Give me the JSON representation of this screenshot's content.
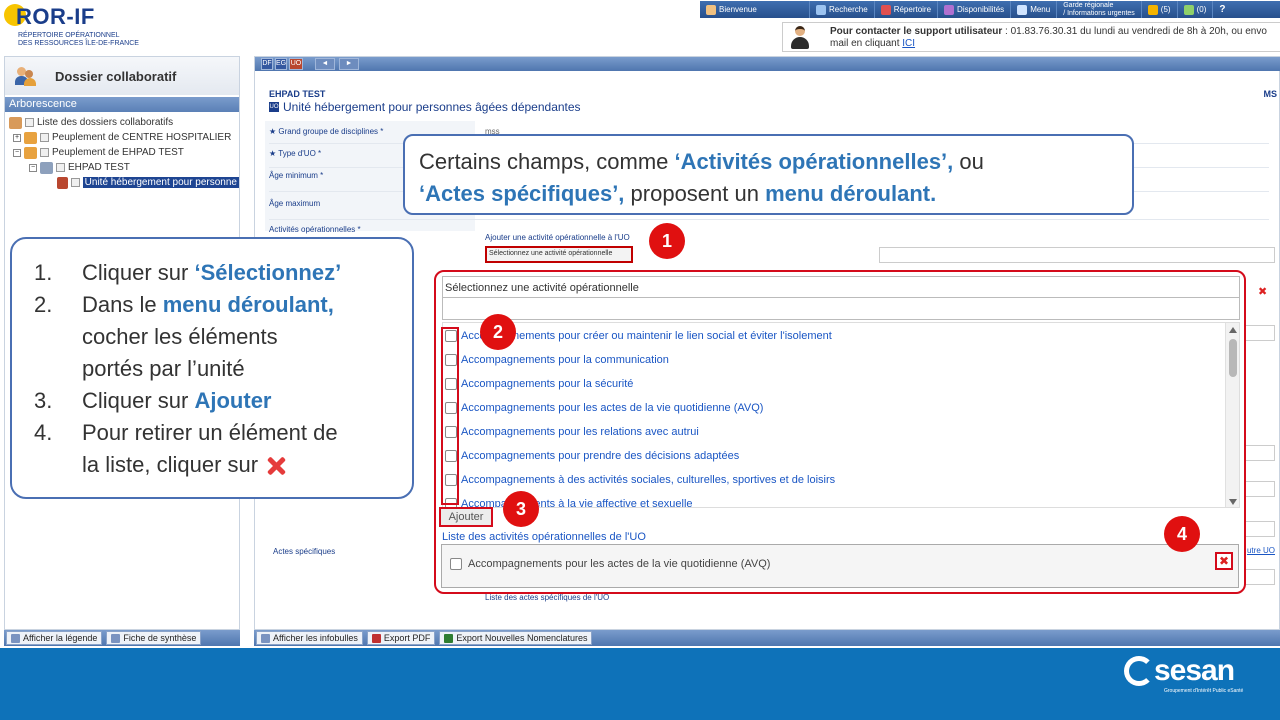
{
  "header": {
    "logo_title": "ROR-IF",
    "logo_sub_1": "RÉPERTOIRE OPÉRATIONNEL",
    "logo_sub_2": "DES RESSOURCES ÎLE-DE-FRANCE",
    "nav": {
      "bienvenue": "Bienvenue",
      "recherche": "Recherche",
      "repertoire": "Répertoire",
      "disponibilites": "Disponibilités",
      "menu": "Menu",
      "garde_1": "Garde régionale",
      "garde_2": "/ Informations urgentes",
      "alerts_count": "(5)",
      "notif_count": "(0)",
      "help": "?"
    },
    "support": {
      "bold": "Pour contacter le support utilisateur",
      "line1_rest": " : 01.83.76.30.31 du lundi au vendredi de 8h à 20h, ou envo",
      "line2": "mail en cliquant ",
      "link": "ICI"
    }
  },
  "left_panel": {
    "title": "Dossier collaboratif",
    "arbo": "Arborescence",
    "tree": {
      "root": "Liste des dossiers collaboratifs",
      "item1": "Peuplement de CENTRE HOSPITALIER",
      "item2": "Peuplement de EHPAD TEST",
      "item3": "EHPAD TEST",
      "item4": "Unité hébergement pour personne"
    },
    "bottom": {
      "legende": "Afficher la légende",
      "synthese": "Fiche de synthèse"
    }
  },
  "main": {
    "toolbar": {
      "df": "DF",
      "eg": "EG",
      "uo": "UO"
    },
    "ehpad": "EHPAD TEST",
    "uo_badge": "UO",
    "uo_title": "Unité hébergement pour personnes âgées dépendantes",
    "ms": "MS",
    "fields": {
      "grand_groupe": "Grand groupe de disciplines *",
      "grand_groupe_value": "mss",
      "type_uo": "Type d'UO *",
      "age_min": "Âge minimum *",
      "age_max": "Âge maximum",
      "activites": "Activités opérationnelles *",
      "actes": "Actes spécifiques"
    },
    "ajouter_activite_label": "Ajouter une activité opérationnelle à l'UO",
    "select_placeholder": "Sélectionnez une activité opérationnelle",
    "actes_bottom": "Liste des actes spécifiques de l'UO",
    "autre_uo": "utre UO",
    "bottom": {
      "infobulles": "Afficher les infobulles",
      "pdf": "Export PDF",
      "nomenclatures": "Export Nouvelles Nomenclatures"
    }
  },
  "dropdown": {
    "header": "Sélectionnez une activité opérationnelle",
    "items": [
      "Accompagnements pour créer ou maintenir le lien social et éviter l'isolement",
      "Accompagnements pour la communication",
      "Accompagnements pour la sécurité",
      "Accompagnements pour les actes de la vie quotidienne (AVQ)",
      "Accompagnements pour les relations avec autrui",
      "Accompagnements pour prendre des décisions adaptées",
      "Accompagnements à des activités sociales, culturelles, sportives et de loisirs",
      "Accompagnements à la vie affective et sexuelle"
    ],
    "ajouter": "Ajouter",
    "liste_label": "Liste des activités opérationnelles de l'UO",
    "liste_item": "Accompagnements pour les actes de la vie quotidienne (AVQ)",
    "remove": "✖"
  },
  "steps": {
    "s1": "1",
    "s2": "2",
    "s3": "3",
    "s4": "4"
  },
  "callout_top": {
    "t1": "Certains champs, comme ",
    "h1": "‘Activités opérationnelles’,",
    "t2": " ou",
    "h2": "‘Actes spécifiques’,",
    "t3": " proposent un ",
    "h3": "menu déroulant."
  },
  "callout_left": {
    "n1": "1.",
    "l1a": "Cliquer sur ",
    "l1b": "‘Sélectionnez’",
    "n2": "2.",
    "l2a": "Dans le ",
    "l2b": "menu déroulant,",
    "l2c": "cocher les éléments",
    "l2d": "portés par l’unité",
    "n3": "3.",
    "l3a": "Cliquer sur ",
    "l3b": "Ajouter",
    "n4": "4.",
    "l4a": "Pour retirer un élément de",
    "l4b": "la liste, cliquer sur "
  },
  "footer": {
    "brand": "sesan",
    "brand_sub": "Groupement d'Intérêt Public eSanté"
  },
  "colors": {
    "accent_red": "#d40b1b",
    "highlight_blue": "#2e75b6",
    "footer_blue": "#0e72b9",
    "nav_blue": "#274f8c"
  }
}
